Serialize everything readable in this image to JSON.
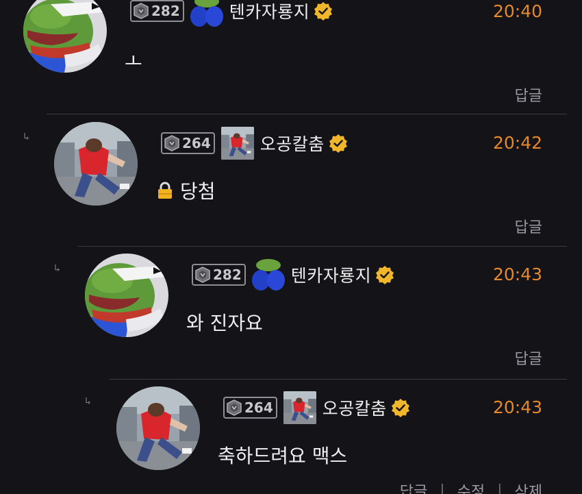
{
  "comments": [
    {
      "level": "282",
      "nickname": "텐카자룡지",
      "time": "20:40",
      "text": "ㅗ",
      "avatar_icon": "frog-avatar-icon",
      "badge_icon": "blue-frog-icon",
      "actions": [
        "답글"
      ]
    },
    {
      "level": "264",
      "nickname": "오공칼춤",
      "time": "20:42",
      "text": "당첨",
      "text_icon": "lock-icon",
      "avatar_icon": "running-man-avatar-icon",
      "badge_icon": "running-man-icon",
      "actions": [
        "답글"
      ]
    },
    {
      "level": "282",
      "nickname": "텐카자룡지",
      "time": "20:43",
      "text": "와 진자요",
      "avatar_icon": "frog-avatar-icon",
      "badge_icon": "blue-frog-icon",
      "actions": [
        "답글"
      ]
    },
    {
      "level": "264",
      "nickname": "오공칼춤",
      "time": "20:43",
      "text": "축하드려요 맥스",
      "avatar_icon": "running-man-avatar-icon",
      "badge_icon": "running-man-icon",
      "actions": [
        "답글",
        "수정",
        "삭제"
      ]
    }
  ],
  "reply_marker": "↳",
  "action_separator": "|",
  "colors": {
    "background": "#141317",
    "time": "#e48a2c",
    "verified": "#f2b62a",
    "divider": "#3a3a40"
  }
}
